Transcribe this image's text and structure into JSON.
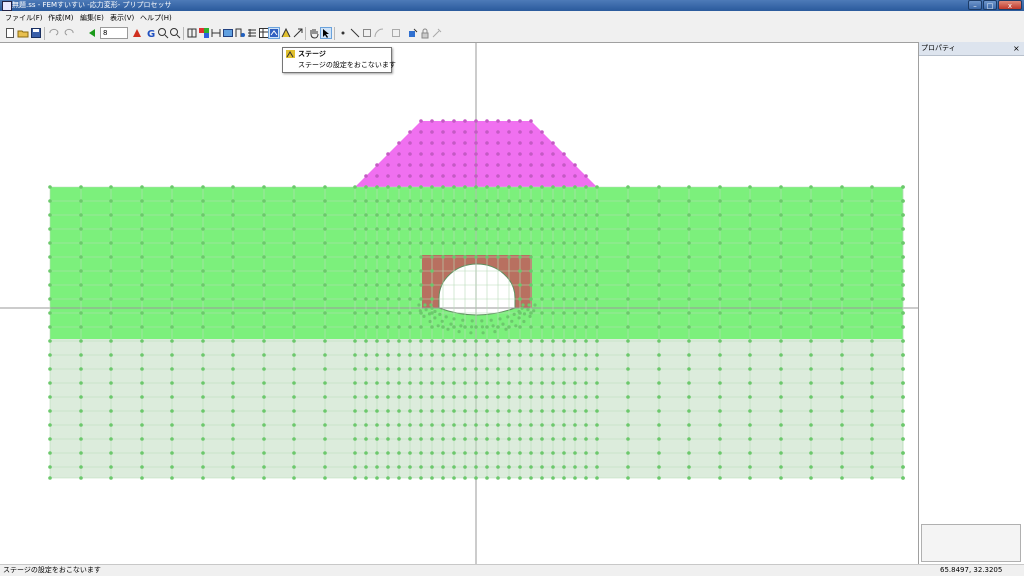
{
  "window": {
    "title": "無題.ss - FEMすいすい -応力変形- プリプロセッサ",
    "minimize_glyph": "–",
    "maximize_glyph": "□",
    "close_glyph": "x"
  },
  "menu": [
    "ファイル(F)",
    "作成(M)",
    "編集(E)",
    "表示(V)",
    "ヘルプ(H)"
  ],
  "toolbar": {
    "zoom_value": "8",
    "icons": [
      "new-icon",
      "open-icon",
      "save-icon",
      "undo-icon",
      "redo-icon",
      "prev-icon",
      "next-icon",
      "grid-icon",
      "zoom-in-icon",
      "zoom-out-icon",
      "material-icon",
      "color-icon",
      "dimension-icon",
      "node-icon",
      "element-icon",
      "mesh-icon",
      "table-icon",
      "stage-icon",
      "stage2-icon",
      "arrow-icon",
      "hand-icon",
      "pointer-icon",
      "point-icon",
      "line-icon",
      "rect-icon",
      "arc-icon",
      "rect2-icon",
      "fill-icon",
      "lock-icon",
      "tool-icon"
    ]
  },
  "tooltip": {
    "title": "ステージ",
    "description": "ステージの設定をおこないます"
  },
  "property_panel": {
    "title": "プロパティ",
    "close_glyph": "×"
  },
  "status": {
    "message": "ステージの設定をおこないます",
    "coordinates": "65.8497, 32.3205"
  },
  "colors": {
    "embankment": "#f070f0",
    "upper_layer": "#7cf07c",
    "lower_layer": "#dcecdc",
    "tunnel_lining": "#b87060",
    "node": "#6cc86c"
  }
}
